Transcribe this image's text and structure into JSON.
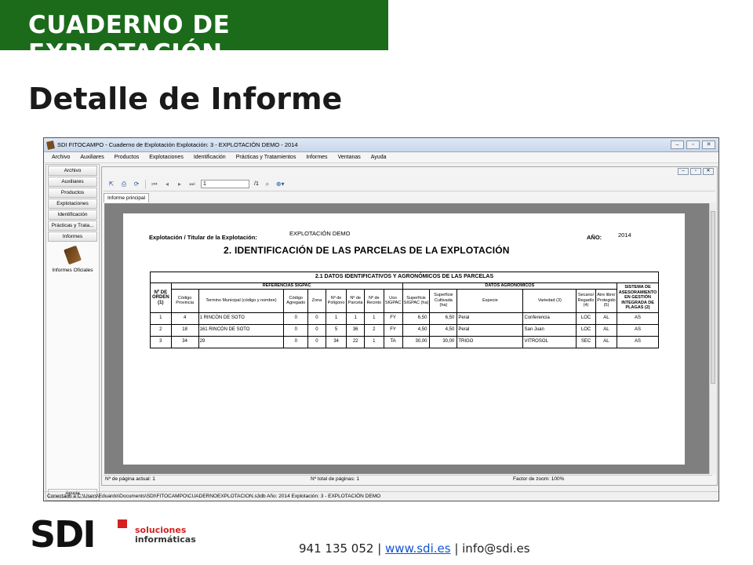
{
  "slide": {
    "banner": "CUADERNO DE EXPLOTACIÓN",
    "title": "Detalle de Informe"
  },
  "app": {
    "titlebar": "SDI FITOCAMPO - Cuaderno de Explotación        Explotación: 3 - EXPLOTACIÓN DEMO - 2014",
    "menu": [
      "Archivo",
      "Auxiliares",
      "Productos",
      "Explotaciones",
      "Identificación",
      "Prácticas y Tratamientos",
      "Informes",
      "Ventanas",
      "Ayuda"
    ],
    "nav": [
      "Archivo",
      "Auxiliares",
      "Productos",
      "Explotaciones",
      "Identificación",
      "Prácticas y Trata...",
      "Informes"
    ],
    "nav_oficiales": "Informes Oficiales",
    "nav_help": "Ayuda",
    "toolbar": {
      "page_value": "1",
      "page_total": "/1"
    },
    "tab": "Informe principal",
    "status": {
      "current_page": "Nº de página actual: 1",
      "total_pages": "Nº total de páginas: 1",
      "zoom": "Factor de zoom: 100%"
    },
    "app_status": "Conectado a C:\\Users\\Eduardo\\Documents\\SDI\\FITOCAMPO\\CUADERNOEXPLOTACION.s3db   Año: 2014   Explotación: 3 - EXPLOTACIÓN DEMO"
  },
  "report": {
    "holder_label": "Explotación / Titular de la Explotación:",
    "holder_value": "EXPLOTACIÓN DEMO",
    "year_label": "AÑO:",
    "year_value": "2014",
    "title": "2. IDENTIFICACIÓN DE LAS PARCELAS DE LA EXPLOTACIÓN",
    "table_title": "2.1 DATOS IDENTIFICATIVOS Y AGRONÓMICOS DE LAS PARCELAS",
    "group_sigpac": "REFERENCIAS SIGPAC",
    "group_agro": "DATOS AGRONÓMICOS",
    "col_orden": "Nº DE ORDEN (1)",
    "col_sistema": "SISTEMA DE ASESORAMIENTO EN GESTIÓN INTEGRADA DE PLAGAS (2)",
    "columns": [
      "Código Provincia",
      "Termino Municipal (código y nombre)",
      "Código Agregado",
      "Zona",
      "Nº de Polígono",
      "Nº de Parcela",
      "Nº de Recinto",
      "Uso SIGPAC",
      "Superficie SIGPAC (ha)",
      "Superficie Cultivada (ha)",
      "Especie",
      "Variedad (3)",
      "Secano/ Regadío (4)",
      "Aire libre/ Protegido (5)"
    ],
    "rows": [
      [
        "1",
        "4",
        "1    RINCÓN DE SOTO",
        "0",
        "0",
        "1",
        "1",
        "1",
        "FY",
        "6,50",
        "6,50",
        "Peral",
        "Conferencia",
        "LOC",
        "AL",
        "AS"
      ],
      [
        "2",
        "18",
        "161 RINCÓN DE SOTO",
        "0",
        "0",
        "5",
        "36",
        "2",
        "FY",
        "4,50",
        "4,50",
        "Peral",
        "San Juan",
        "LOC",
        "AL",
        "AS"
      ],
      [
        "3",
        "34",
        "29",
        "0",
        "0",
        "34",
        "22",
        "1",
        "TA",
        "30,00",
        "30,00",
        "TRIGO",
        "VITROSOL",
        "SEC",
        "AL",
        "AS"
      ]
    ]
  },
  "footer": {
    "logo_text": "SDI",
    "logo_sub1": "soluciones",
    "logo_sub2": "informáticas",
    "phone": "941 135 052",
    "sep1": " | ",
    "web": "www.sdi.es",
    "sep2": " | ",
    "email": "info@sdi.es"
  },
  "colors": {
    "banner": "#1b6b1b",
    "accent_red": "#d32020",
    "link": "#1155cc"
  }
}
